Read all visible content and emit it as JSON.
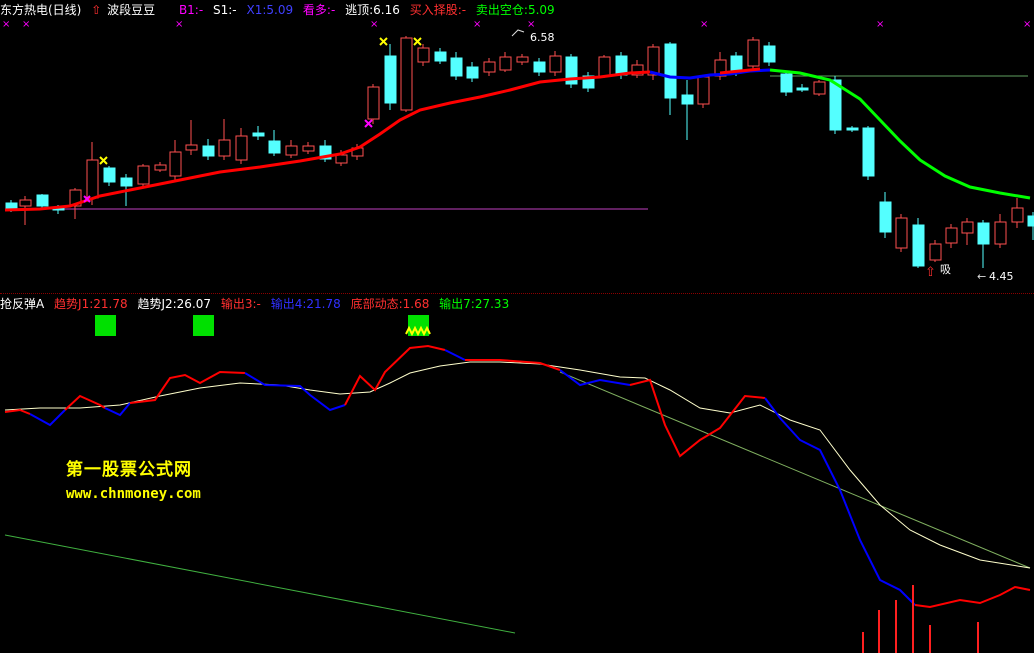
{
  "top_indicator": {
    "symbol": "东方热电(日线)",
    "arrow": "⇧",
    "name": "波段豆豆",
    "b1": "B1:-",
    "s1": "S1:-",
    "x1": "X1:5.09",
    "look_long": "看多:-",
    "escape_top": "逃顶:6.16",
    "buy_select": "买入择股:-",
    "sell_empty": "卖出空仓:5.09"
  },
  "bottom_indicator": {
    "name": "抢反弹A",
    "trend1": "趋势J1:21.78",
    "trend2": "趋势J2:26.07",
    "out3": "输出3:-",
    "out4": "输出4:21.78",
    "bottom_dyn": "底部动态:1.68",
    "out7": "输出7:27.33"
  },
  "annotations": {
    "high_label": "6.58",
    "low_label": "4.45",
    "absorb_label": "吸",
    "up_arrow": "⇧"
  },
  "watermark": {
    "title": "第一股票公式网",
    "url": "www.chnmoney.com"
  },
  "colors": {
    "bg": "#000000",
    "up_candle": "#ff5050",
    "down_candle": "#54ffff",
    "ma_red": "#ff0000",
    "ma_blue": "#0000ff",
    "ma_green": "#00ff00",
    "j1_red": "#ff0000",
    "j1_blue": "#0000ff",
    "j2_line": "#ffffcc",
    "signal_box": "#00e000",
    "magenta": "#ff00ff",
    "yellow": "#ffff00"
  }
}
